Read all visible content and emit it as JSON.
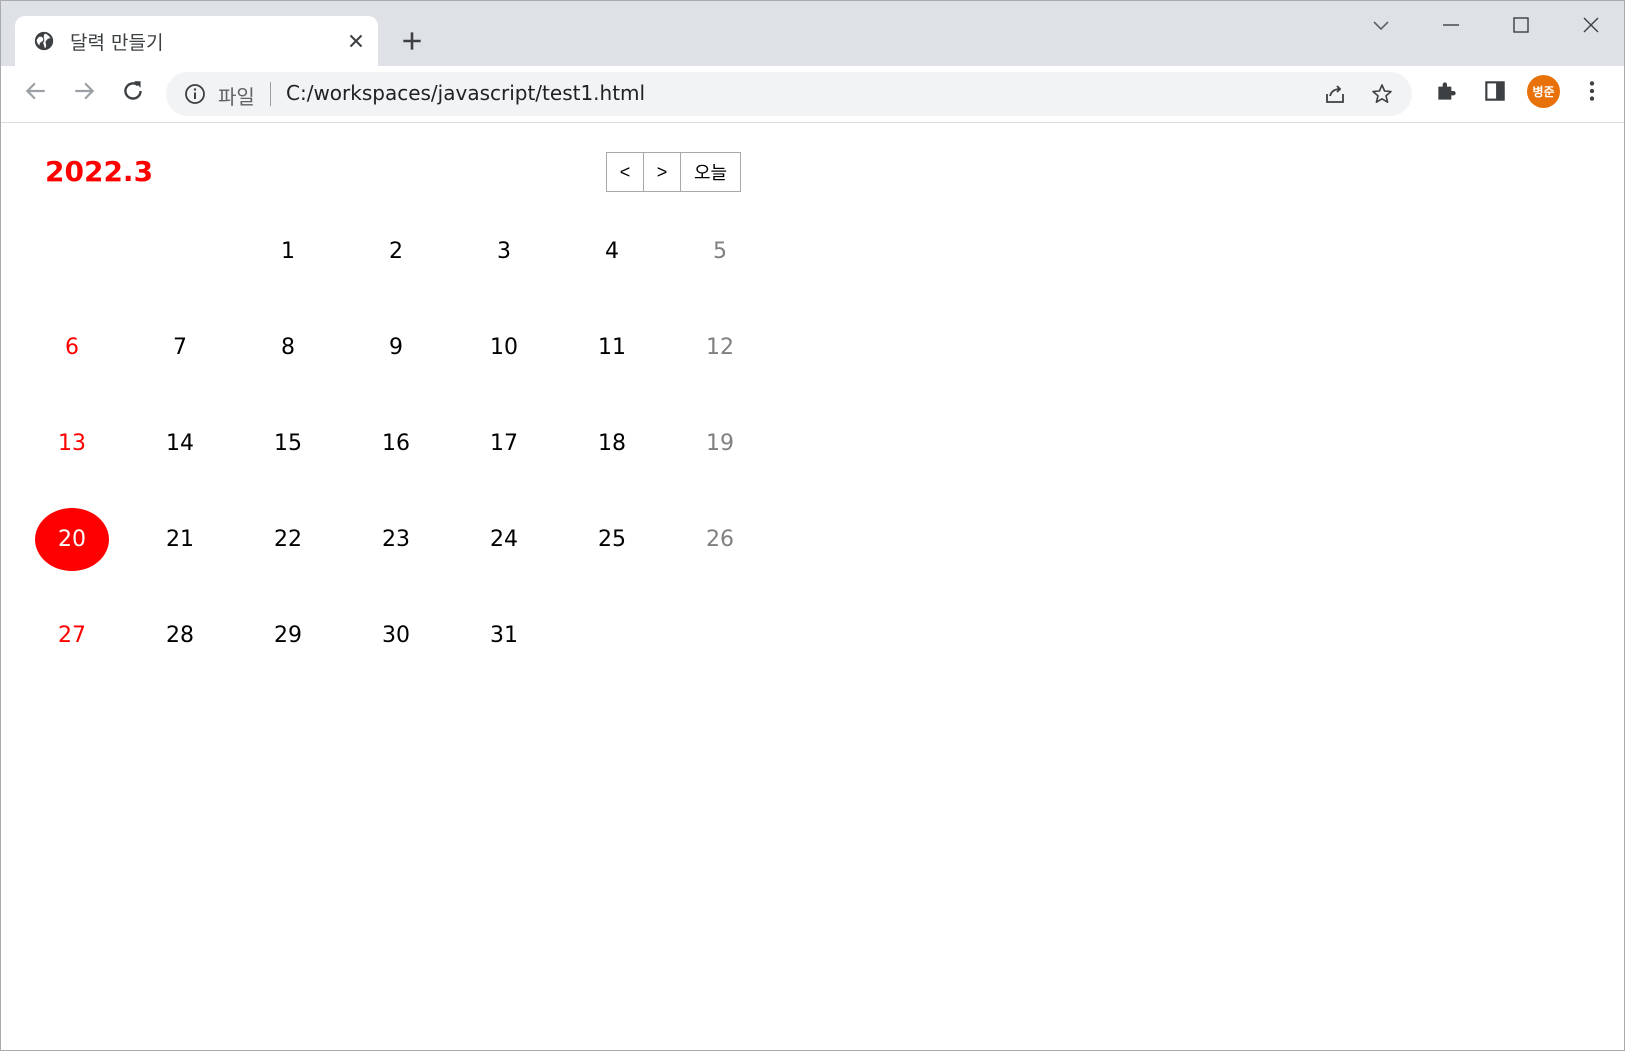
{
  "browser": {
    "tab_title": "달력 만들기",
    "address_scheme": "파일",
    "address_url": "C:/workspaces/javascript/test1.html",
    "profile_initials": "병준"
  },
  "calendar": {
    "title": "2022.3",
    "prev_label": "<",
    "next_label": ">",
    "today_label": "오늘",
    "today_date": "20",
    "weeks": [
      [
        "",
        "",
        "1",
        "2",
        "3",
        "4",
        "5"
      ],
      [
        "6",
        "7",
        "8",
        "9",
        "10",
        "11",
        "12"
      ],
      [
        "13",
        "14",
        "15",
        "16",
        "17",
        "18",
        "19"
      ],
      [
        "20",
        "21",
        "22",
        "23",
        "24",
        "25",
        "26"
      ],
      [
        "27",
        "28",
        "29",
        "30",
        "31",
        "",
        ""
      ]
    ]
  },
  "colors": {
    "accent": "#ff0000",
    "sunday": "#ff0000",
    "saturday": "#808080",
    "avatar": "#e8710a"
  }
}
